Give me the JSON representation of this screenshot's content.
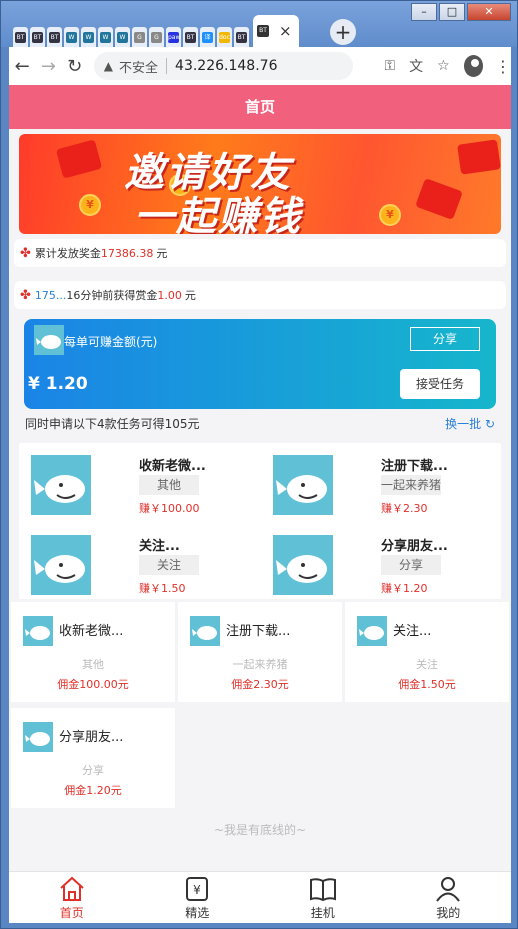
{
  "browser": {
    "tabs": [
      {
        "favicon": "BT"
      },
      {
        "favicon": "BT"
      },
      {
        "favicon": "BT"
      },
      {
        "favicon": "W"
      },
      {
        "favicon": "W"
      },
      {
        "favicon": "W"
      },
      {
        "favicon": "W"
      },
      {
        "favicon": "G"
      },
      {
        "favicon": "G"
      },
      {
        "favicon": "paw"
      },
      {
        "favicon": "BT"
      },
      {
        "favicon": "译"
      },
      {
        "favicon": "doc"
      },
      {
        "favicon": "BT"
      }
    ],
    "active_tab_close": "×",
    "new_tab": "+",
    "security_label": "不安全",
    "url": "43.226.148.76"
  },
  "header": {
    "title": "首页"
  },
  "banner": {
    "line1": "邀请好友",
    "line2": "一起赚钱"
  },
  "notices": [
    {
      "prefix": "累计发放奖金",
      "value": "17386.38",
      "suffix": "元"
    },
    {
      "user": "175...",
      "middle": "16分钟前获得赏金",
      "value": "1.00",
      "suffix": "元"
    }
  ],
  "earn_card": {
    "label": "每单可赚金额(元)",
    "share": "分享",
    "amount": "¥ 1.20",
    "accept": "接受任务"
  },
  "hint": {
    "text": "同时申请以下4款任务可得105元",
    "refresh": "换一批"
  },
  "featured": [
    {
      "name": "收新老微...",
      "tag": "其他",
      "price": "赚￥100.00"
    },
    {
      "name": "注册下载...",
      "tag": "一起来养猪",
      "price": "赚￥2.30"
    },
    {
      "name": "关注...",
      "tag": "关注",
      "price": "赚￥1.50"
    },
    {
      "name": "分享朋友...",
      "tag": "分享",
      "price": "赚￥1.20"
    }
  ],
  "tasks": [
    {
      "name": "收新老微...",
      "tag": "其他",
      "commission": "佣金100.00元"
    },
    {
      "name": "注册下载...",
      "tag": "一起来养猪",
      "commission": "佣金2.30元"
    },
    {
      "name": "关注...",
      "tag": "关注",
      "commission": "佣金1.50元"
    },
    {
      "name": "分享朋友...",
      "tag": "分享",
      "commission": "佣金1.20元"
    }
  ],
  "bottom_line": "~我是有底线的~",
  "tabbar": [
    {
      "label": "首页",
      "icon": "home-icon",
      "active": true
    },
    {
      "label": "精选",
      "icon": "yen-card-icon",
      "active": false
    },
    {
      "label": "挂机",
      "icon": "book-icon",
      "active": false
    },
    {
      "label": "我的",
      "icon": "user-icon",
      "active": false
    }
  ],
  "colors": {
    "header": "#f1617e",
    "accent_red": "#e0302a",
    "card_gradient_start": "#1a84e6",
    "card_gradient_end": "#16b6cc",
    "link_blue": "#2a7fd6"
  }
}
